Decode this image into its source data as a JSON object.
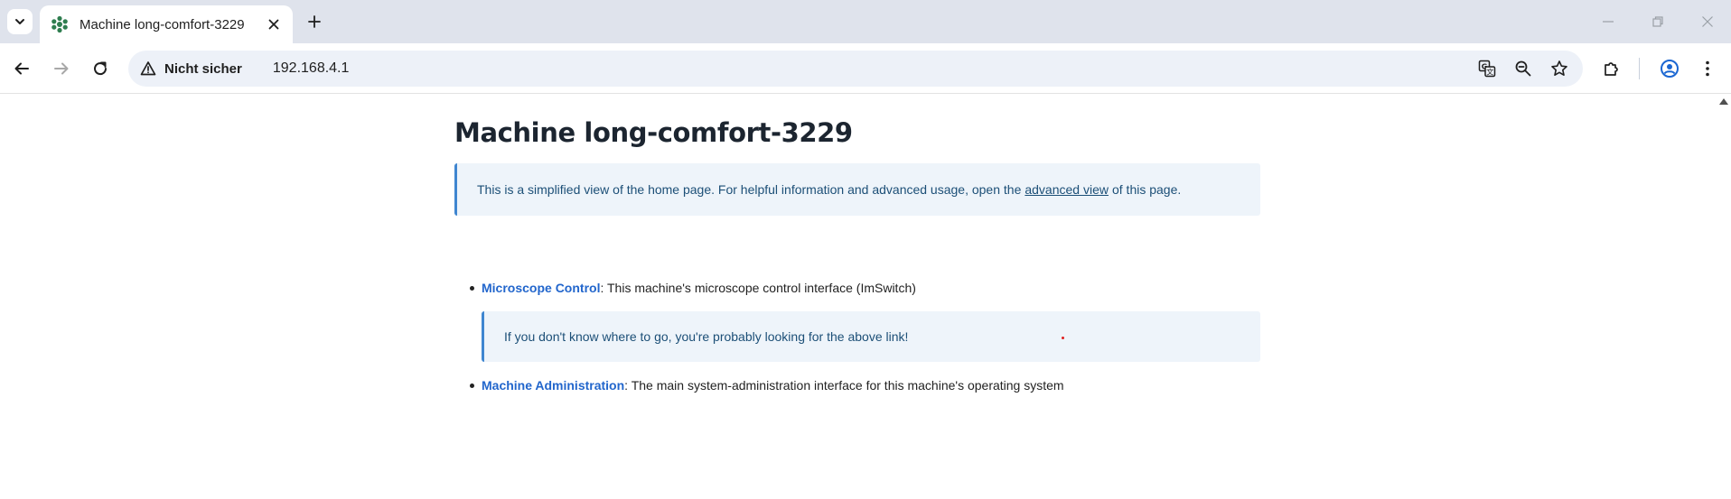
{
  "browser": {
    "tab_title": "Machine long-comfort-3229",
    "security_label": "Nicht sicher",
    "url": "192.168.4.1"
  },
  "page": {
    "title": "Machine long-comfort-3229",
    "notice": {
      "before_link": "This is a simplified view of the home page. For helpful information and advanced usage, open the",
      "link_text": "advanced view",
      "after_link": "of this page."
    },
    "links": [
      {
        "name": "Microscope Control",
        "separator": ":",
        "description": " This machine's microscope control interface (ImSwitch)"
      },
      {
        "name": "Machine Administration",
        "separator": ":",
        "description": " The main system-administration interface for this machine's operating system"
      }
    ],
    "hint": "If you don't know where to go, you're probably looking for the above link!"
  },
  "colors": {
    "link": "#2266cc",
    "notice_border": "#3f86d0",
    "notice_bg": "#eef4fa",
    "title": "#1c2530"
  }
}
